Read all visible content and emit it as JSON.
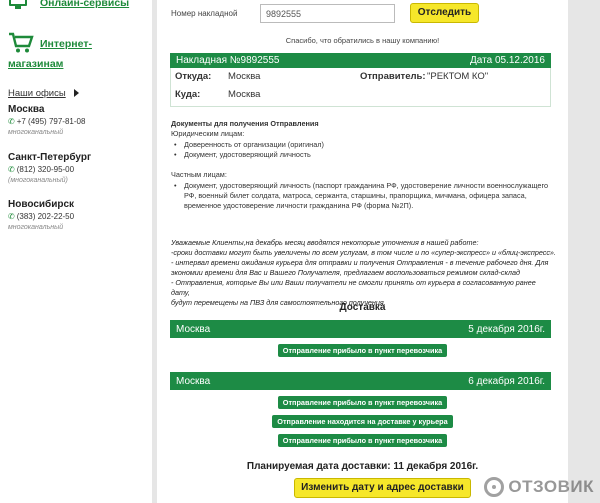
{
  "sidebar": {
    "links": {
      "online_services": "Онлайн-сервисы",
      "internet_shops_1": "Интернет-",
      "internet_shops_2": "магазинам"
    },
    "offices_label": "Наши офисы",
    "cities": [
      {
        "name": "Москва",
        "phone": "+7 (495) 797-81-08",
        "note": "многоканальный"
      },
      {
        "name": "Санкт-Петербург",
        "phone": "(812) 320-95-00",
        "note": "(многоканальный)"
      },
      {
        "name": "Новосибирск",
        "phone": "(383) 202-22-50",
        "note": "многоканальный"
      }
    ]
  },
  "tracking": {
    "label": "Номер накладной",
    "value": "9892555",
    "button": "Отследить",
    "thanks": "Спасибо, что обратились в нашу компанию!"
  },
  "waybill": {
    "title": "Накладная №9892555",
    "date": "Дата 05.12.2016",
    "from_label": "Откуда:",
    "from_value": "Москва",
    "to_label": "Куда:",
    "to_value": "Москва",
    "sender_label": "Отправитель:",
    "sender_value": "\"РЕКТОМ КО\""
  },
  "documents": {
    "title": "Документы для получения Отправления",
    "legal_label": "Юридическим лицам:",
    "legal_items": [
      "Доверенность от организации (оригинал)",
      "Документ, удостоверяющий личность"
    ],
    "private_label": "Частным лицам:",
    "private_items": [
      "Документ, удостоверяющий личность (паспорт гражданина РФ, удостоверение личности военнослужащего",
      "РФ, военный билет солдата, матроса, сержанта, старшины, прапорщика, мичмана, офицера запаса,",
      "временное удостоверение личности гражданина РФ (форма №2П)."
    ]
  },
  "notice": [
    "Уважаемые Клиенты,на декабрь месяц вводятся некоторые уточнения в нашей работе:",
    "-сроки доставки могут быть увеличены по всем услугам, в том числе и по «супер-экспресс» и «блиц-экспресс».",
    "- интервал времени ожидания курьера для отправки и получения Отправления - в течение рабочего дня. Для",
    "экономии времени для Вас и Вашего Получателя, предлагаем воспользоваться режимом склад-склад",
    "- Отправления, которые Вы или Ваши получатели не смогли принять от курьера в согласованную ранее дату,",
    "будут перемещены на ПВЗ для самостоятельного получения."
  ],
  "delivery": {
    "title": "Доставка",
    "days": [
      {
        "city": "Москва",
        "date": "5 декабря 2016г.",
        "statuses": [
          "Отправление прибыло в пункт перевозчика"
        ]
      },
      {
        "city": "Москва",
        "date": "6 декабря 2016г.",
        "statuses": [
          "Отправление прибыло в пункт перевозчика",
          "Отправление находится на доставке у курьера",
          "Отправление прибыло в пункт перевозчика"
        ]
      }
    ],
    "planned": "Планируемая дата доставки: 11 декабря 2016г.",
    "change_button": "Изменить дату и адрес доставки"
  },
  "watermark": "ОТЗОВИК"
}
